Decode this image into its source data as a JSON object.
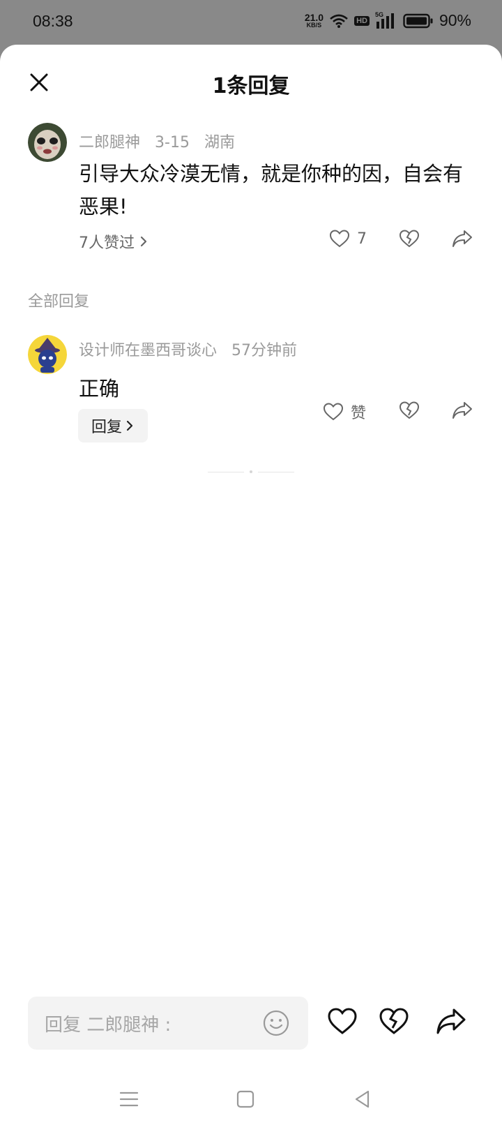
{
  "status_bar": {
    "time": "08:38",
    "net_speed_value": "21.0",
    "net_speed_unit": "KB/S",
    "hd_badge": "HD",
    "signal_label": "5G",
    "battery_percent": "90%",
    "icons": [
      "wifi-icon",
      "hd-icon",
      "signal-icon",
      "battery-icon"
    ]
  },
  "header": {
    "title": "1条回复",
    "close_icon": "close-icon"
  },
  "main_comment": {
    "username": "二郎腿神",
    "date": "3-15",
    "location": "湖南",
    "text": "引导大众冷漠无情，就是你种的因，自会有恶果!",
    "likers_text": "7人赞过",
    "like_count": "7",
    "icons": [
      "heart-icon",
      "dislike-icon",
      "share-icon"
    ]
  },
  "replies_section": {
    "label": "全部回复",
    "replies": [
      {
        "username": "设计师在墨西哥谈心",
        "time": "57分钟前",
        "text": "正确",
        "reply_button_label": "回复",
        "like_label": "赞"
      }
    ]
  },
  "bottom_bar": {
    "input_placeholder": "回复 二郎腿神 :",
    "icons": [
      "emoji-icon",
      "heart-icon",
      "dislike-icon",
      "share-icon"
    ]
  },
  "nav_bar": {
    "icons": [
      "menu-icon",
      "home-icon",
      "back-icon"
    ]
  },
  "colors": {
    "overlay": "#898989",
    "sheet": "#ffffff",
    "primary_text": "#111111",
    "secondary_text": "#9a9a9a",
    "input_bg": "#f3f3f3"
  }
}
